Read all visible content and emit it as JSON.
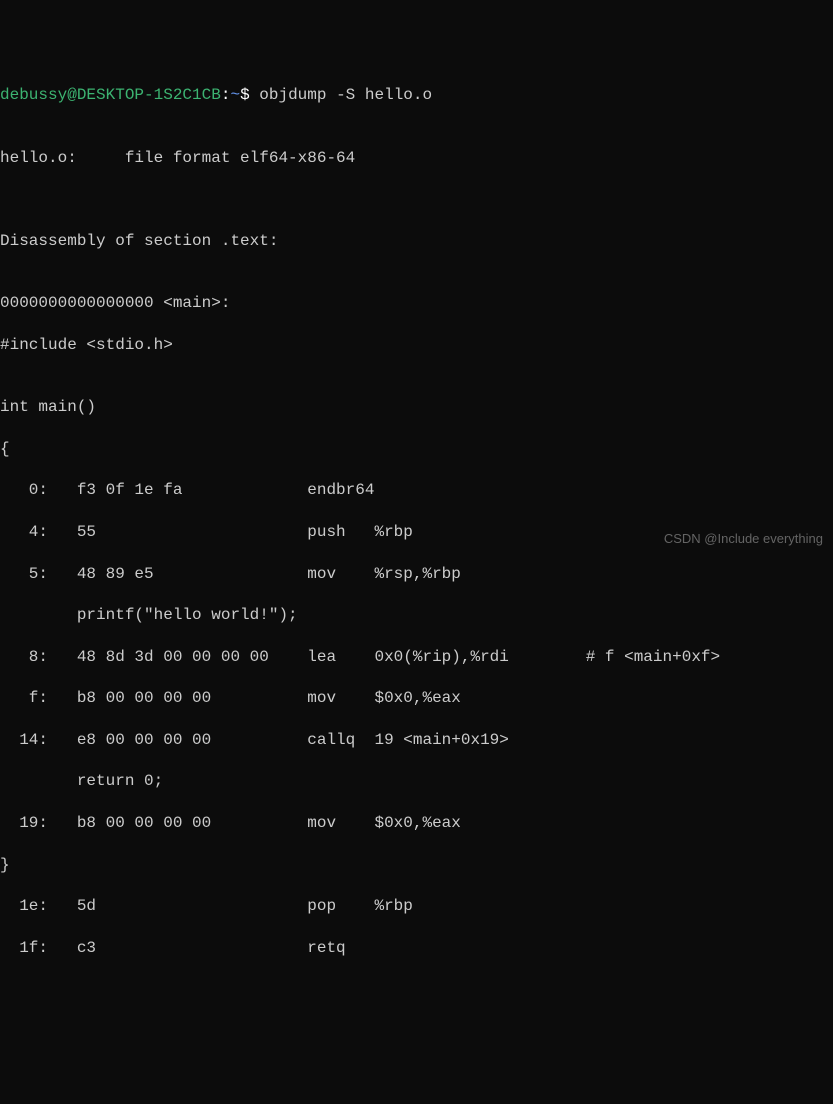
{
  "prompt": {
    "user_host": "debussy@DESKTOP-1S2C1CB",
    "separator": ":",
    "path": "~",
    "dollar": "$ ",
    "command": "objdump -S hello.o"
  },
  "lines": {
    "blank": "",
    "file_header": "hello.o:     file format elf64-x86-64",
    "disasm_section": "Disassembly of section .text:",
    "symbol": "0000000000000000 <main>:",
    "include": "#include <stdio.h>",
    "main_decl": "int main()",
    "brace_open": "{",
    "l0": "   0:   f3 0f 1e fa             endbr64",
    "l4": "   4:   55                      push   %rbp",
    "l5": "   5:   48 89 e5                mov    %rsp,%rbp",
    "printf": "        printf(\"hello world!\");",
    "l8": "   8:   48 8d 3d 00 00 00 00    lea    0x0(%rip),%rdi        # f <main+0xf>",
    "lf": "   f:   b8 00 00 00 00          mov    $0x0,%eax",
    "l14": "  14:   e8 00 00 00 00          callq  19 <main+0x19>",
    "return": "        return 0;",
    "l19": "  19:   b8 00 00 00 00          mov    $0x0,%eax",
    "brace_close": "}",
    "l1e": "  1e:   5d                      pop    %rbp",
    "l1f": "  1f:   c3                      retq"
  },
  "watermark": "CSDN @Include everything"
}
